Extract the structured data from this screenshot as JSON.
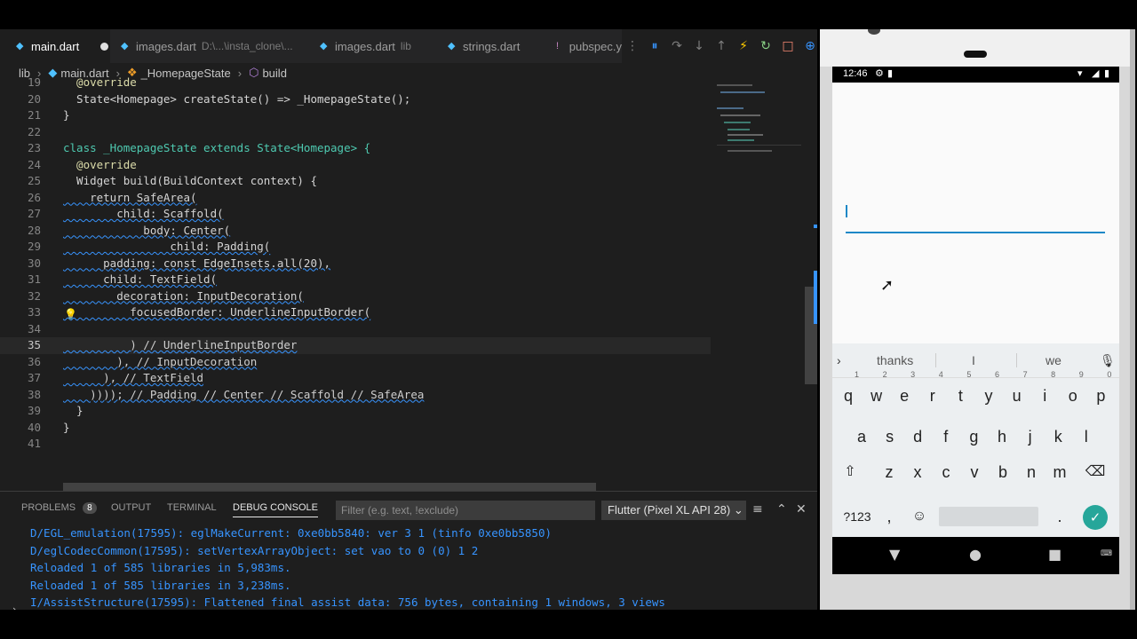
{
  "tabs": [
    {
      "label": "main.dart",
      "sub": "",
      "active": true
    },
    {
      "label": "images.dart",
      "sub": "D:\\...\\insta_clone\\..."
    },
    {
      "label": "images.dart",
      "sub": "lib"
    },
    {
      "label": "strings.dart",
      "sub": ""
    },
    {
      "label": "pubspec.y",
      "sub": ""
    }
  ],
  "breadcrumb": {
    "root": "lib",
    "file": "main.dart",
    "class": "_HomepageState",
    "method": "build"
  },
  "editor": {
    "lines": [
      {
        "n": "19",
        "text": "  @override"
      },
      {
        "n": "20",
        "text": "  State<Homepage> createState() => _HomepageState();"
      },
      {
        "n": "21",
        "text": "}"
      },
      {
        "n": "22",
        "text": ""
      },
      {
        "n": "23",
        "text": "class _HomepageState extends State<Homepage> {"
      },
      {
        "n": "24",
        "text": "  @override"
      },
      {
        "n": "25",
        "text": "  Widget build(BuildContext context) {"
      },
      {
        "n": "26",
        "text": "    return SafeArea("
      },
      {
        "n": "27",
        "text": "        child: Scaffold("
      },
      {
        "n": "28",
        "text": "            body: Center("
      },
      {
        "n": "29",
        "text": "                child: Padding("
      },
      {
        "n": "30",
        "text": "      padding: const EdgeInsets.all(20),"
      },
      {
        "n": "31",
        "text": "      child: TextField("
      },
      {
        "n": "32",
        "text": "        decoration: InputDecoration("
      },
      {
        "n": "33",
        "text": "          focusedBorder: UnderlineInputBorder("
      },
      {
        "n": "34",
        "text": ""
      },
      {
        "n": "35",
        "text": "          ) // UnderlineInputBorder"
      },
      {
        "n": "36",
        "text": "        ), // InputDecoration"
      },
      {
        "n": "37",
        "text": "      ), // TextField"
      },
      {
        "n": "38",
        "text": "    )))); // Padding // Center // Scaffold // SafeArea"
      },
      {
        "n": "39",
        "text": "  }"
      },
      {
        "n": "40",
        "text": "}"
      },
      {
        "n": "41",
        "text": ""
      }
    ]
  },
  "panel": {
    "problems_label": "PROBLEMS",
    "problems_count": "8",
    "output_label": "OUTPUT",
    "terminal_label": "TERMINAL",
    "debug_label": "DEBUG CONSOLE",
    "filter_placeholder": "Filter (e.g. text, !exclude)",
    "device": "Flutter (Pixel XL API 28)",
    "log": [
      "D/EGL_emulation(17595): eglMakeCurrent: 0xe0bb5840: ver 3 1 (tinfo 0xe0bb5850)",
      "D/eglCodecCommon(17595): setVertexArrayObject: set vao to 0 (0) 1 2",
      "Reloaded 1 of 585 libraries in 5,983ms.",
      "Reloaded 1 of 585 libraries in 3,238ms.",
      "I/AssistStructure(17595): Flattened final assist data: 756 bytes, containing 1 windows, 3 views"
    ]
  },
  "phone": {
    "time": "12:46",
    "suggestions": [
      "thanks",
      "I",
      "we"
    ],
    "row1": [
      [
        "q",
        "1"
      ],
      [
        "w",
        "2"
      ],
      [
        "e",
        "3"
      ],
      [
        "r",
        "4"
      ],
      [
        "t",
        "5"
      ],
      [
        "y",
        "6"
      ],
      [
        "u",
        "7"
      ],
      [
        "i",
        "8"
      ],
      [
        "o",
        "9"
      ],
      [
        "p",
        "0"
      ]
    ],
    "row2": [
      "a",
      "s",
      "d",
      "f",
      "g",
      "h",
      "j",
      "k",
      "l"
    ],
    "row3": [
      "z",
      "x",
      "c",
      "v",
      "b",
      "n",
      "m"
    ],
    "sym_label": "?123",
    "comma": ",",
    "period": "."
  }
}
